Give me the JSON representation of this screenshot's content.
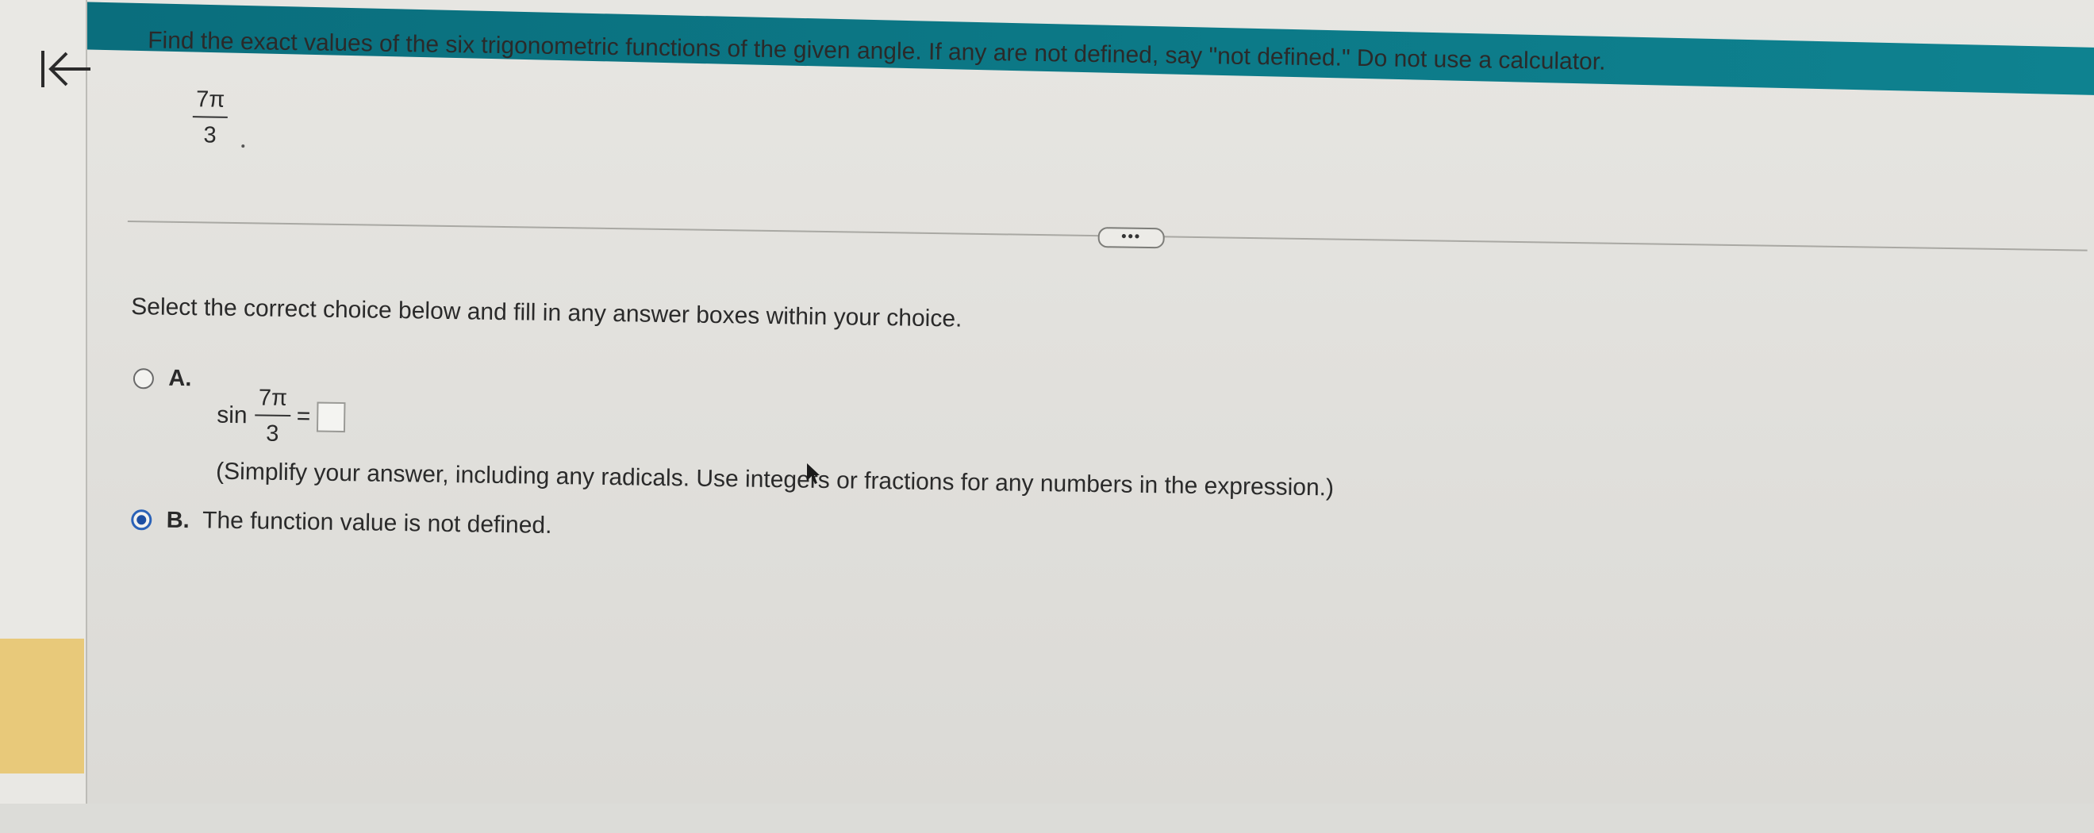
{
  "question": {
    "prompt": "Find the exact values of the six trigonometric functions of the given angle. If any are not defined, say \"not defined.\" Do not use a calculator.",
    "angle_numerator": "7π",
    "angle_denominator": "3"
  },
  "more_button_label": "•••",
  "instruction": "Select the correct choice below and fill in any answer boxes within your choice.",
  "options": {
    "a": {
      "letter": "A.",
      "function": "sin",
      "numerator": "7π",
      "denominator": "3",
      "equals": "=",
      "answer_value": "",
      "hint": "(Simplify your answer, including any radicals. Use integers or fractions for any numbers in the expression.)",
      "selected": false
    },
    "b": {
      "letter": "B.",
      "text": "The function value is not defined.",
      "selected": true
    }
  },
  "colors": {
    "accent": "#0c7886",
    "radio_selected": "#1d4fa3",
    "rail_highlight": "#e8c97a"
  }
}
